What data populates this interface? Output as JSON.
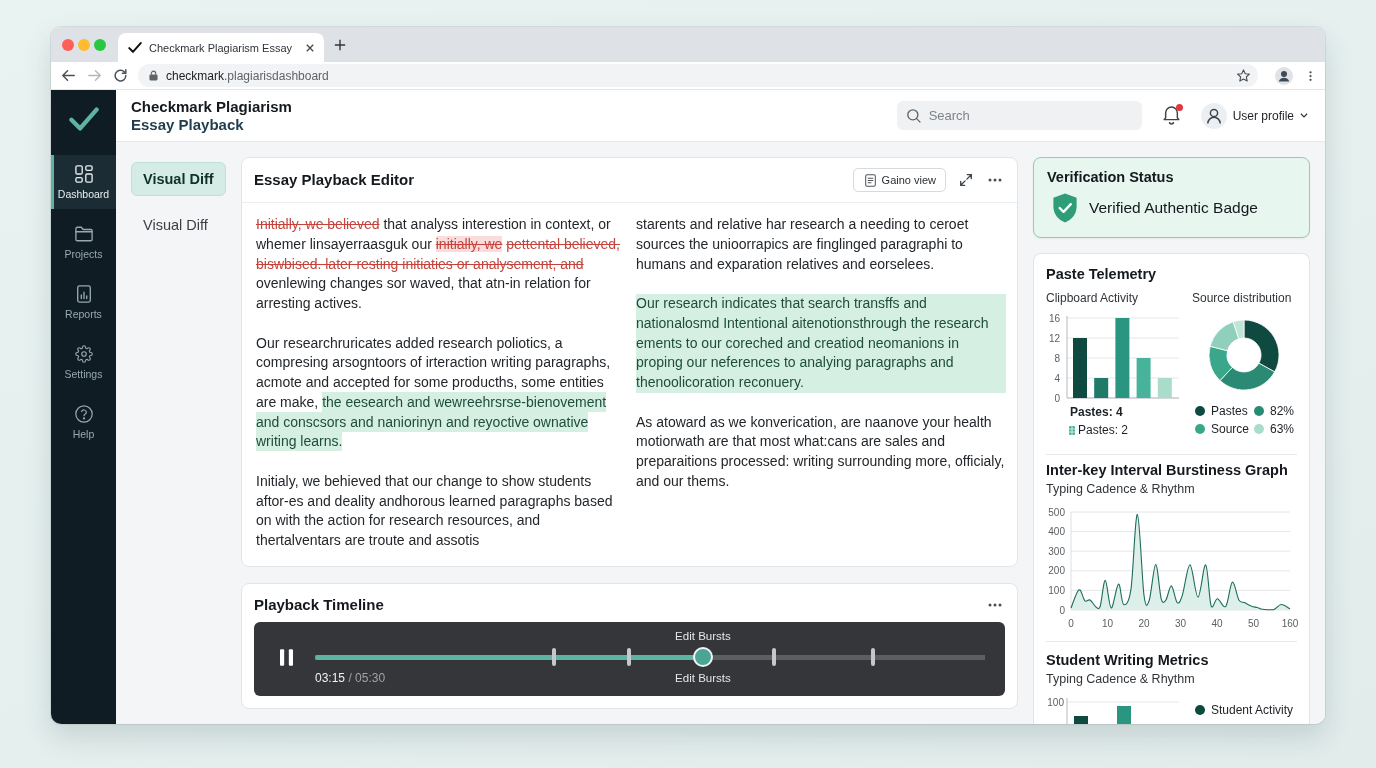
{
  "browser": {
    "tab_title": "Checkmark Plagiarism Essay",
    "url": {
      "host": "checkmark",
      "path": ".plagiarisdashboard"
    }
  },
  "sidebar": {
    "items": [
      {
        "label": "Dashboard",
        "selected": true
      },
      {
        "label": "Projects",
        "selected": false
      },
      {
        "label": "Reports",
        "selected": false
      },
      {
        "label": "Settings",
        "selected": false
      },
      {
        "label": "Help",
        "selected": false
      }
    ]
  },
  "header": {
    "title": "Checkmark Plagiarism",
    "subtitle": "Essay Playback",
    "search": {
      "placeholder": "Search"
    },
    "notifications": {
      "unread": true
    },
    "user": {
      "label": "User profile"
    }
  },
  "subnav": {
    "items": [
      {
        "label": "Visual Diff",
        "selected": true
      },
      {
        "label": "Visual Diff",
        "selected": false
      }
    ]
  },
  "editor": {
    "title": "Essay Playback Editor",
    "view_button": "Gaino view",
    "columns": [
      [
        {
          "kind": "plain",
          "segments": [
            {
              "kind": "struck",
              "text": "Initially, we believed"
            },
            {
              "kind": "plain",
              "text": "that analyss interestion in context, or whemer linsayerraasguk our"
            },
            {
              "kind": "removed",
              "text": "initially, we"
            },
            {
              "kind": "struck",
              "text": "pettental believed, biswbised. later resting initiaties or analysement, and"
            },
            {
              "kind": "plain",
              "text": "ovenlewing changes sor waved, that atn-in relation for arresting actives."
            }
          ]
        },
        {
          "kind": "plain",
          "segments": [
            {
              "kind": "plain",
              "text": "Our researchruricates added research poliotics, a compresing arsogntoors of irteraction writing paragraphs, acmote and accepted for some producths, some entities are make,"
            },
            {
              "kind": "added",
              "text": "the eesearch and wewreehrsrse-bienovement and conscsors and naniorinyn and reyoctive ownative writing learns."
            }
          ]
        },
        {
          "kind": "plain",
          "segments": [
            {
              "kind": "plain",
              "text": "Initialy, we behieved that our change to show students aftor-es and deality andhorous learned paragraphs based on with the action for research resources, and thertalventars are troute and assotis"
            }
          ]
        }
      ],
      [
        {
          "kind": "plain",
          "segments": [
            {
              "kind": "plain",
              "text": "starents and relative har research a needing to ceroet sources the unioorrapics are finglinged paragraphi to humans and exparation relatives and eorselees."
            }
          ]
        },
        {
          "kind": "added",
          "segments": [
            {
              "kind": "plain",
              "text": "Our research indicates that search transffs and nationalosmd Intentional aitenotionsthrough the research ements to our coreched and creatiod neomanions in proping our neferences to analying paragraphs and thenoolicoration reconuery."
            }
          ]
        },
        {
          "kind": "plain",
          "segments": [
            {
              "kind": "plain",
              "text": "As atoward as we konverication, are naanove your health motiorwath are that most what:cans are sales and preparaitions processed: writing surrounding more, officialy, and our thems."
            }
          ]
        }
      ]
    ]
  },
  "timeline": {
    "title": "Playback Timeline",
    "playing": true,
    "level": 0.579,
    "markers": [
      {
        "level": 0.356
      },
      {
        "level": 0.469
      },
      {
        "level": 0.685
      },
      {
        "level": 0.833
      }
    ],
    "label_above": "Edit Bursts",
    "label_below": "Edit Bursts",
    "elapsed": "03:15",
    "duration": "/ 05:30"
  },
  "verification": {
    "title": "Verification Status",
    "badge": "Verified Authentic Badge",
    "verified": true
  },
  "telemetry": {
    "title": "Paste Telemetry",
    "clipboard": {
      "chart_data": {
        "type": "bar",
        "title": "Clipboard Activity",
        "values": [
          12,
          4,
          16,
          8,
          4
        ],
        "ylim": [
          0,
          16
        ],
        "yticks": [
          0,
          4,
          8,
          12,
          16
        ],
        "grid": true
      },
      "notes": [
        {
          "kind": "total",
          "text": "Pastes: 4"
        },
        {
          "kind": "legend",
          "text": "Pastes: 2"
        }
      ]
    },
    "distribution": {
      "title": "Source distribution",
      "legend": [
        {
          "label": "Pastes",
          "color": "#0e4a40"
        },
        {
          "label": "82%",
          "color": "#2b8a74"
        },
        {
          "label": "Source",
          "color": "#3aa78b"
        },
        {
          "label": "63%",
          "color": "#a8dccc"
        }
      ]
    },
    "burstiness": {
      "title": "Inter-key Interval Burstiness Graph",
      "subtitle": "Typing Cadence & Rhythm",
      "chart_data": {
        "type": "area",
        "x": [
          0,
          2.2,
          3.8,
          5.2,
          7,
          8,
          9.4,
          11,
          13,
          14.4,
          16.4,
          18.2,
          20,
          21.4,
          23.2,
          24.7,
          26,
          27.5,
          29.1,
          30.5,
          32.6,
          34.8,
          36.9,
          38.4,
          40.1,
          42.4,
          44.2,
          46,
          47.5,
          49.5,
          51,
          52.5,
          55.5,
          57.6,
          60
        ],
        "values": [
          10,
          103,
          47,
          51,
          13,
          19,
          151,
          10,
          132,
          28,
          104,
          487,
          75,
          47,
          232,
          57,
          51,
          123,
          38,
          75,
          230,
          66,
          230,
          19,
          57,
          19,
          142,
          51,
          38,
          19,
          13,
          4,
          2,
          28,
          6
        ],
        "xlim": [
          0,
          60
        ],
        "ylim": [
          0,
          500
        ],
        "xticks": [
          0,
          10,
          20,
          30,
          40,
          50
        ],
        "yticks": [
          0,
          100,
          200,
          300,
          400,
          500
        ],
        "grid": true
      },
      "axis_end_label": "160"
    },
    "student_metrics": {
      "title": "Student Writing Metrics",
      "subtitle": "Typing Cadence & Rhythm",
      "axis_label": "100",
      "legend": [
        {
          "label": "Student Activity",
          "color": "#0e4a40"
        }
      ]
    }
  }
}
